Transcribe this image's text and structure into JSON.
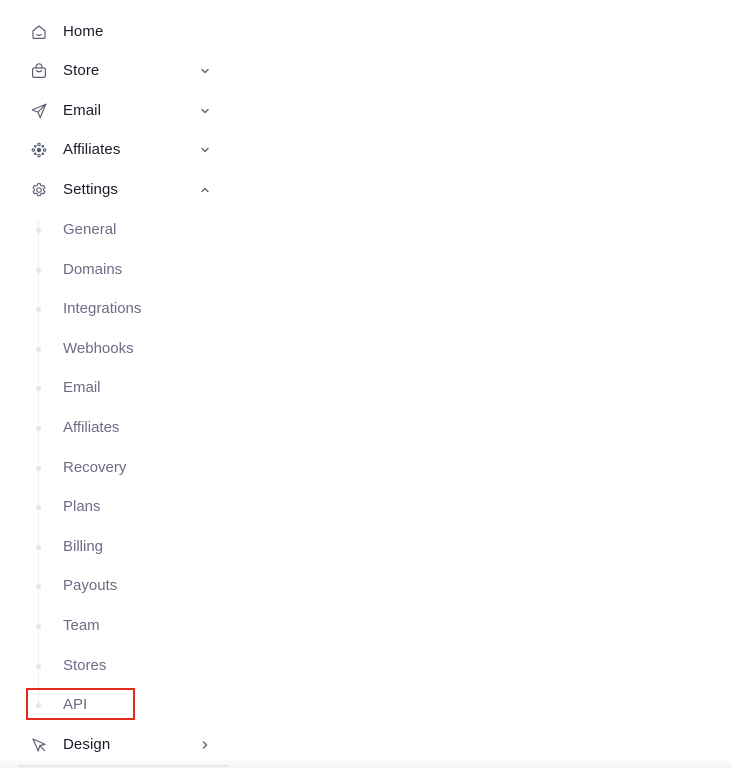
{
  "nav": {
    "home": {
      "label": "Home",
      "icon": "home-icon"
    },
    "store": {
      "label": "Store",
      "icon": "shopping-bag-icon",
      "state": "collapsed"
    },
    "email": {
      "label": "Email",
      "icon": "send-icon",
      "state": "collapsed"
    },
    "affiliates": {
      "label": "Affiliates",
      "icon": "network-dots-icon",
      "state": "collapsed"
    },
    "settings": {
      "label": "Settings",
      "icon": "gear-icon",
      "state": "expanded",
      "items": [
        {
          "label": "General"
        },
        {
          "label": "Domains"
        },
        {
          "label": "Integrations"
        },
        {
          "label": "Webhooks"
        },
        {
          "label": "Email"
        },
        {
          "label": "Affiliates"
        },
        {
          "label": "Recovery"
        },
        {
          "label": "Plans"
        },
        {
          "label": "Billing"
        },
        {
          "label": "Payouts"
        },
        {
          "label": "Team"
        },
        {
          "label": "Stores"
        },
        {
          "label": "API"
        }
      ]
    },
    "design": {
      "label": "Design",
      "icon": "cursor-arrow-icon",
      "state": "collapsed"
    }
  },
  "highlight": {
    "target": "API",
    "color": "#e32a1d"
  },
  "colors": {
    "primary_text": "#1b1b2a",
    "secondary_text": "#6e6c86",
    "icon": "#5b5f73"
  }
}
